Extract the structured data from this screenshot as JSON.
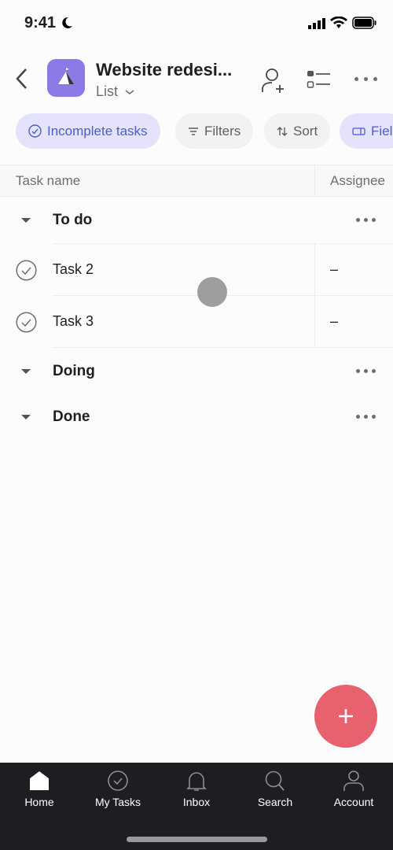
{
  "status": {
    "time": "9:41"
  },
  "header": {
    "title": "Website redesi...",
    "view": "List"
  },
  "chips": [
    {
      "label": "Incomplete tasks"
    },
    {
      "label": "Filters"
    },
    {
      "label": "Sort"
    },
    {
      "label": "Fiel"
    }
  ],
  "table": {
    "columns": [
      "Task name",
      "Assignee"
    ]
  },
  "sections": [
    {
      "name": "To do",
      "tasks": [
        {
          "name": "Task 2",
          "assignee": "–"
        },
        {
          "name": "Task 3",
          "assignee": "–"
        }
      ]
    },
    {
      "name": "Doing",
      "tasks": []
    },
    {
      "name": "Done",
      "tasks": []
    }
  ],
  "tabbar": [
    {
      "label": "Home",
      "icon": "home-icon"
    },
    {
      "label": "My Tasks",
      "icon": "check-circle-icon"
    },
    {
      "label": "Inbox",
      "icon": "bell-icon"
    },
    {
      "label": "Search",
      "icon": "search-icon"
    },
    {
      "label": "Account",
      "icon": "person-icon"
    }
  ],
  "colors": {
    "accent": "#8c79e6",
    "chip_active": "#e4e3fb",
    "fab": "#e8616f",
    "tabbar": "#1e1d22"
  }
}
